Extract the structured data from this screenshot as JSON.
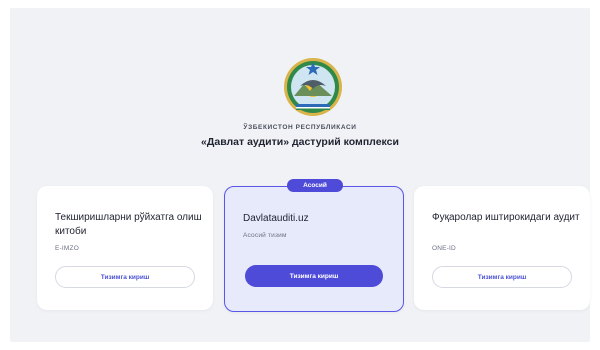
{
  "header": {
    "republic": "ЎЗБЕКИСТОН РЕСПУБЛИКАСИ",
    "complex_title": "«Давлат аудити» дастурий комплекси"
  },
  "cards": [
    {
      "title": "Текширишларни рўйхатга олиш китоби",
      "subtitle": "E-IMZO",
      "button": "Тизимга кириш",
      "badge": ""
    },
    {
      "title": "Davlatauditi.uz",
      "subtitle": "Асосий тизим",
      "button": "Тизимга кириш",
      "badge": "Асосий"
    },
    {
      "title": "Фуқаролар иштирокидаги аудит",
      "subtitle": "ONE-ID",
      "button": "Тизимга кириш",
      "badge": ""
    }
  ],
  "colors": {
    "accent": "#4f4bd9",
    "highlight_card_bg": "#e7eafb",
    "page_bg": "#f1f2f6"
  },
  "icons": {
    "emblem": "state-emblem-icon"
  }
}
